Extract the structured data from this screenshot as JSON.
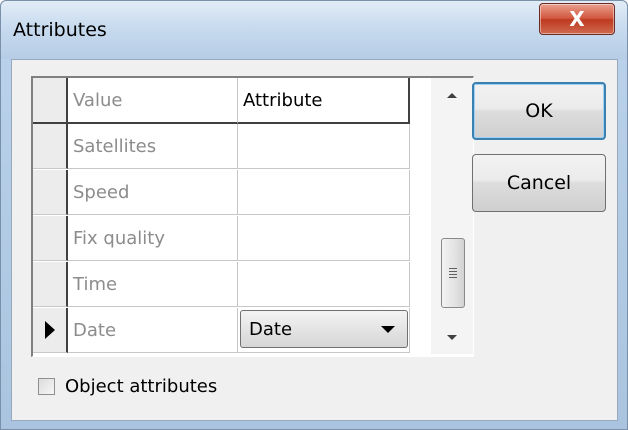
{
  "window": {
    "title": "Attributes",
    "close_label": "X"
  },
  "grid": {
    "columns": [
      "Value",
      "Attribute"
    ],
    "rows": [
      {
        "value": "Satellites",
        "attribute": ""
      },
      {
        "value": "Speed",
        "attribute": ""
      },
      {
        "value": "Fix quality",
        "attribute": ""
      },
      {
        "value": "Time",
        "attribute": ""
      },
      {
        "value": "Date",
        "attribute": "Date"
      }
    ],
    "current_row_index": 4
  },
  "buttons": {
    "ok_label": "OK",
    "cancel_label": "Cancel"
  },
  "checkbox": {
    "label": "Object attributes",
    "checked": false
  },
  "colors": {
    "titlebar": "#c8dbef",
    "close_button": "#d2573f",
    "ok_focus_border": "#3c7fb1",
    "value_text": "#8c8c8c"
  }
}
